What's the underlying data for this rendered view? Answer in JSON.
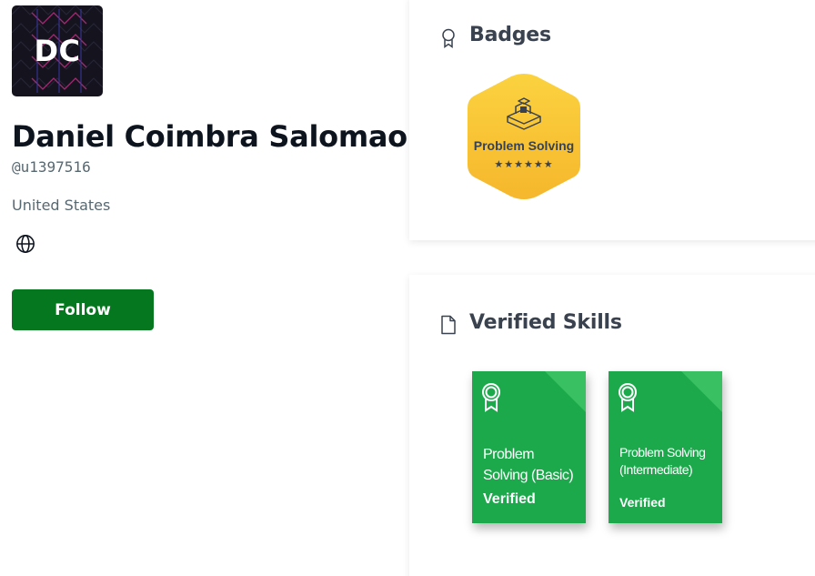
{
  "profile": {
    "avatar_initials": "DC",
    "full_name": "Daniel Coimbra Salomao",
    "username": "@u1397516",
    "location": "United States",
    "follow_label": "Follow"
  },
  "badges": {
    "title": "Badges",
    "items": [
      {
        "name": "Problem Solving",
        "stars": 6,
        "color": "#f8c335"
      }
    ]
  },
  "verified_skills": {
    "title": "Verified Skills",
    "items": [
      {
        "name": "Problem Solving (Basic)",
        "status": "Verified"
      },
      {
        "name": "Problem Solving (Intermediate)",
        "status": "Verified"
      }
    ]
  },
  "colors": {
    "follow_button": "#05771e",
    "skill_card": "#1ba94c",
    "badge_gold": "#f8c335",
    "title_text": "#39424e"
  },
  "icons": {
    "globe": "globe-icon",
    "badges_header": "ribbon-icon",
    "skills_header": "document-icon",
    "skill_card": "award-ribbon-icon"
  }
}
